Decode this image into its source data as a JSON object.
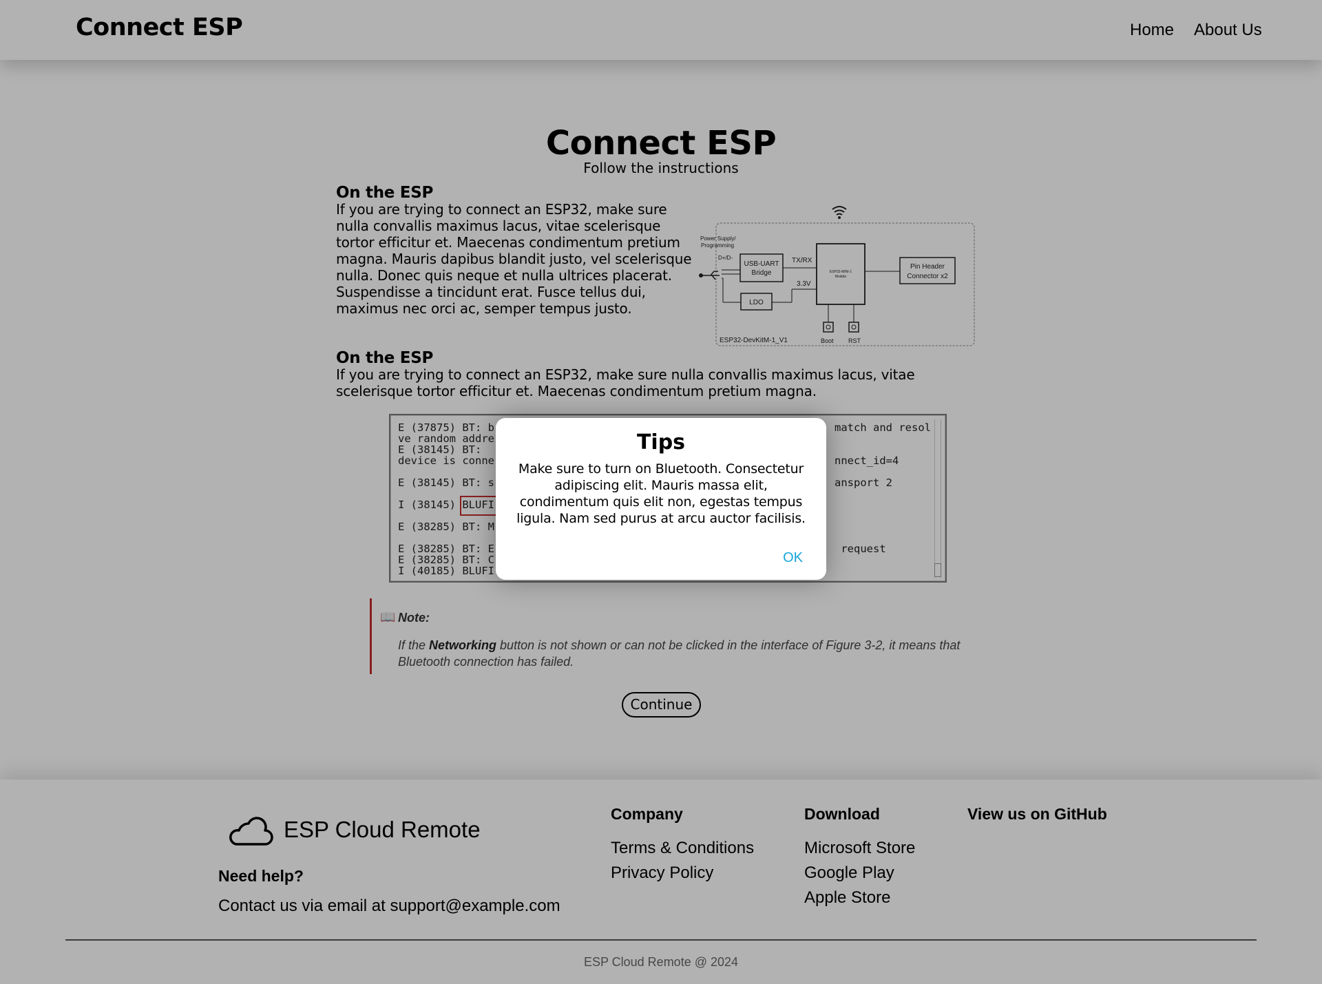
{
  "header": {
    "brand": "Connect ESP",
    "nav": {
      "home": "Home",
      "about": "About Us"
    }
  },
  "main": {
    "title": "Connect ESP",
    "subtitle": "Follow the instructions",
    "sections": [
      {
        "heading": "On the ESP",
        "body": "If you are trying to connect an ESP32, make sure nulla convallis maximus lacus, vitae scelerisque tortor efficitur et. Maecenas condimentum pretium magna. Mauris dapibus blandit justo, vel scelerisque nulla. Donec quis neque et nulla ultrices placerat. Suspendisse a tincidunt erat. Fusce tellus dui, maximus nec orci ac, semper tempus justo."
      },
      {
        "heading": "On the ESP",
        "body": "If you are trying to connect an ESP32, make sure nulla convallis maximus lacus, vitae scelerisque tortor efficitur et. Maecenas condimentum pretium magna."
      }
    ],
    "diagram": {
      "power_label_1": "Power Supply/",
      "power_label_2": "Programming",
      "dplus": "D+/D-",
      "usb_uart_1": "USB-UART",
      "usb_uart_2": "Bridge",
      "txrx": "TX/RX",
      "v33": "3.3V",
      "module_1": "ESP32-MINI-1",
      "module_2": "Module",
      "pin_header_1": "Pin Header",
      "pin_header_2": "Connector  x2",
      "ldo": "LDO",
      "board_name": "ESP32-DevKitM-1_V1",
      "boot": "Boot",
      "rst": "RST"
    },
    "console": {
      "left_lines": [
        "E (37875) BT: b",
        "ve random addre",
        "E (38145) BT:",
        "device is conne",
        "",
        "E (38145) BT: s",
        "",
        "I (38145) BLUFI",
        "",
        "E (38285) BT: M",
        "",
        "E (38285) BT: E",
        "E (38285) BT: C",
        "I (40185) BLUFI"
      ],
      "right_lines": [
        "match and resol",
        "",
        "",
        "nnect_id=4",
        "",
        "ansport 2",
        "",
        "",
        "",
        "",
        "",
        " request"
      ]
    },
    "note": {
      "title": "Note:",
      "text_before": "If the ",
      "text_bold": "Networking",
      "text_after": " button is not shown or can not be clicked in the interface of Figure 3-2, it means that Bluetooth connection has failed."
    },
    "continue_label": "Continue"
  },
  "footer": {
    "brand": "ESP Cloud Remote",
    "help_title": "Need help?",
    "help_text": "Contact us via email at support@example.com",
    "company": {
      "title": "Company",
      "links": [
        "Terms & Conditions",
        "Privacy Policy"
      ]
    },
    "download": {
      "title": "Download",
      "links": [
        "Microsoft Store",
        "Google Play",
        "Apple Store"
      ]
    },
    "github": "View us on GitHub",
    "copyright": "ESP Cloud Remote @ 2024"
  },
  "modal": {
    "title": "Tips",
    "body": "Make sure to turn on Bluetooth. Consectetur adipiscing elit. Mauris massa elit, condimentum quis elit non, egestas tempus ligula. Nam sed purus at arcu auctor facilisis.",
    "ok": "OK"
  },
  "colors": {
    "overlay": "rgba(0,0,0,0.30)",
    "ok_accent": "#16a6d8",
    "note_border": "#c42b2b"
  }
}
